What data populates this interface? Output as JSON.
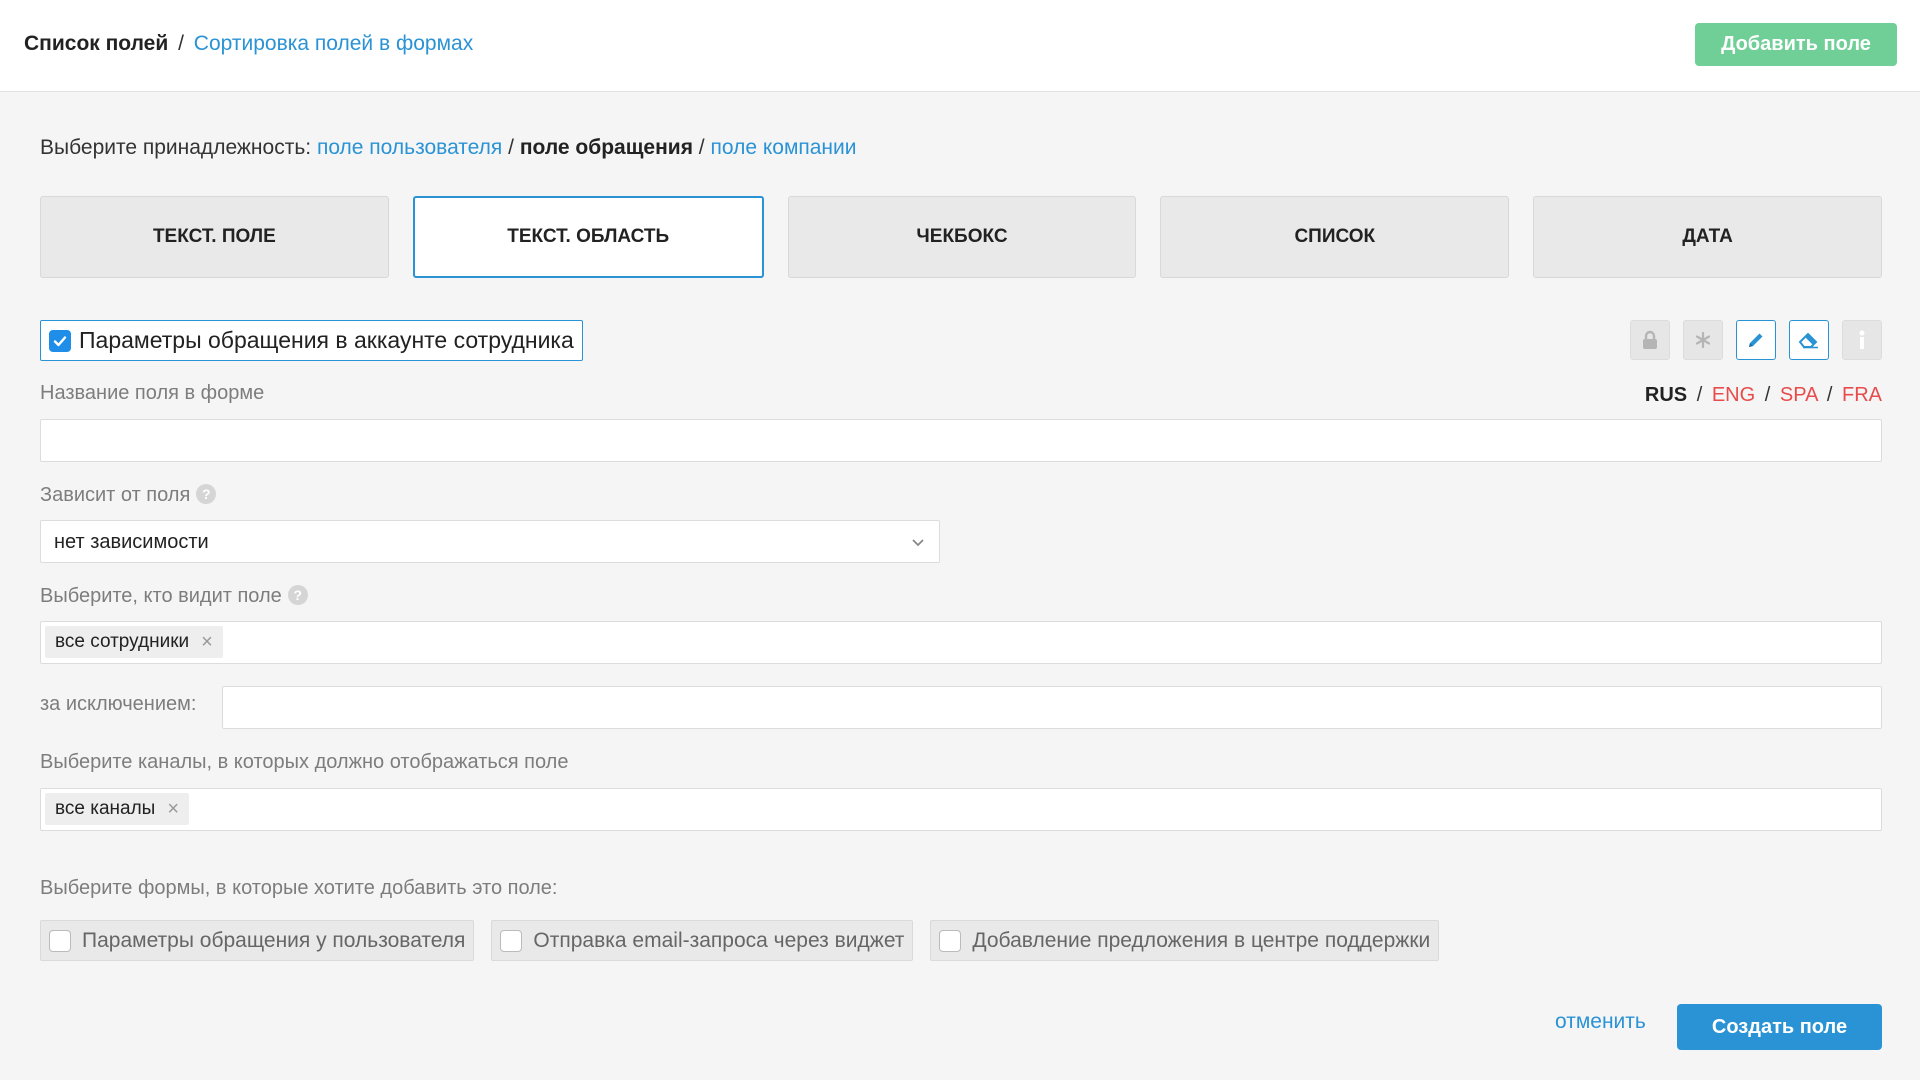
{
  "header": {
    "breadcrumb_current": "Список полей",
    "breadcrumb_sep": "/",
    "breadcrumb_link": "Сортировка полей в формах",
    "add_button": "Добавить поле"
  },
  "belonging": {
    "prefix": "Выберите принадлежность:",
    "options": [
      "поле пользователя",
      "поле обращения",
      "поле компании"
    ],
    "active": "поле обращения",
    "sep": "/"
  },
  "field_types": {
    "items": [
      "ТЕКСТ. ПОЛЕ",
      "ТЕКСТ. ОБЛАСТЬ",
      "ЧЕКБОКС",
      "СПИСОК",
      "ДАТА"
    ],
    "selected": "ТЕКСТ. ОБЛАСТЬ"
  },
  "params_checkbox": {
    "label": "Параметры обращения в аккаунте сотрудника",
    "checked": true
  },
  "tool_icons": [
    "lock-icon",
    "asterisk-icon",
    "pencil-icon",
    "eraser-icon",
    "info-icon"
  ],
  "field_name": {
    "label": "Название поля в форме",
    "value": "",
    "languages": {
      "current": "RUS",
      "others": [
        "ENG",
        "SPA",
        "FRA"
      ],
      "sep": "/"
    }
  },
  "depends": {
    "label": "Зависит от поля",
    "help": "?",
    "value": "нет зависимости"
  },
  "visibility": {
    "label": "Выберите, кто видит поле",
    "help": "?",
    "tag": "все сотрудники",
    "remove": "×",
    "except_label": "за исключением:",
    "except_value": ""
  },
  "channels": {
    "label": "Выберите каналы, в которых должно отображаться поле",
    "tag": "все каналы",
    "remove": "×"
  },
  "forms": {
    "label": "Выберите формы, в которые хотите добавить это поле:",
    "items": [
      {
        "label": "Параметры обращения у пользователя",
        "checked": false
      },
      {
        "label": "Отправка email-запроса через виджет",
        "checked": false
      },
      {
        "label": "Добавление предложения в центре поддержки",
        "checked": false
      }
    ]
  },
  "actions": {
    "cancel": "отменить",
    "create": "Создать поле"
  },
  "colors": {
    "accent": "#2a93d5",
    "add_button": "#6fcf97",
    "lang_link": "#e84b4b",
    "checkbox": "#1f8ee8"
  }
}
